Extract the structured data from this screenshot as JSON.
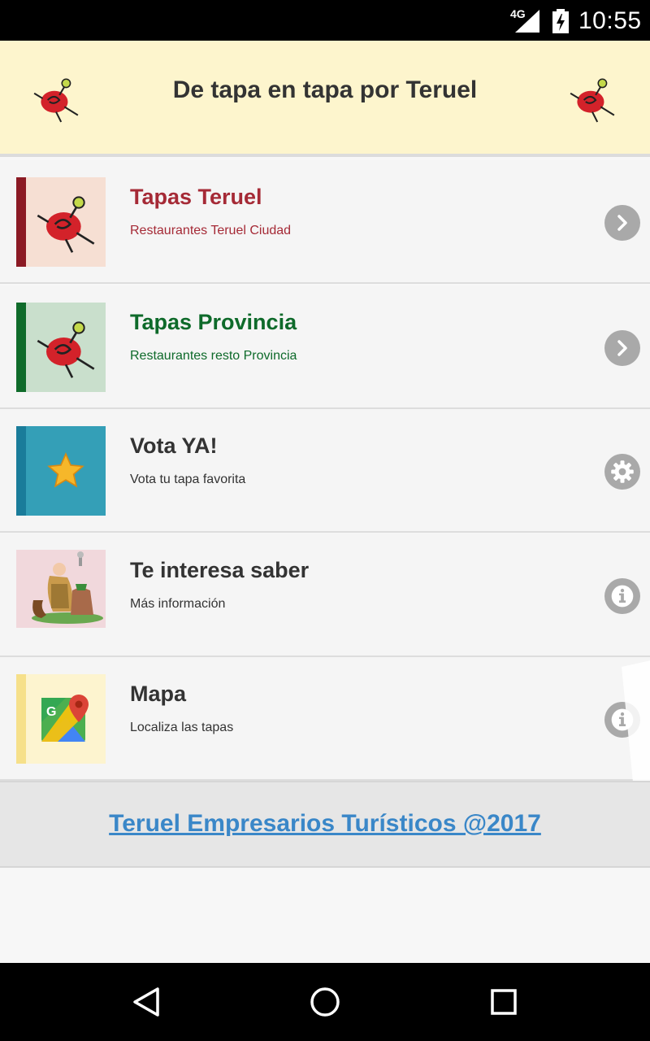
{
  "status_bar": {
    "network": "4G",
    "time": "10:55"
  },
  "header": {
    "title": "De tapa en tapa por Teruel"
  },
  "menu": [
    {
      "title": "Tapas Teruel",
      "subtitle": "Restaurantes Teruel Ciudad",
      "accent": "#a52a36",
      "bar_color": "#8b1a24",
      "thumb_bg": "#f6dfd3",
      "icon": "chevron-right-icon"
    },
    {
      "title": "Tapas Provincia",
      "subtitle": "Restaurantes resto Provincia",
      "accent": "#0e6a2a",
      "bar_color": "#0f6b2a",
      "thumb_bg": "#c9dfcc",
      "icon": "chevron-right-icon"
    },
    {
      "title": "Vota YA!",
      "subtitle": "Vota tu tapa favorita",
      "accent": "#333333",
      "bar_color": "#1a7c9a",
      "thumb_bg": "#349fb7",
      "icon": "gear-icon"
    },
    {
      "title": "Te interesa saber",
      "subtitle": "Más información",
      "accent": "#333333",
      "bar_color": "#f1d8dc",
      "thumb_bg": "#f1d8dc",
      "icon": "info-icon"
    },
    {
      "title": "Mapa",
      "subtitle": "Localiza las tapas",
      "accent": "#333333",
      "bar_color": "#f6e08a",
      "thumb_bg": "#fdf4cf",
      "icon": "info-icon"
    }
  ],
  "footer": {
    "link": "Teruel Empresarios Turísticos @2017",
    "link_color": "#3a87c8"
  }
}
